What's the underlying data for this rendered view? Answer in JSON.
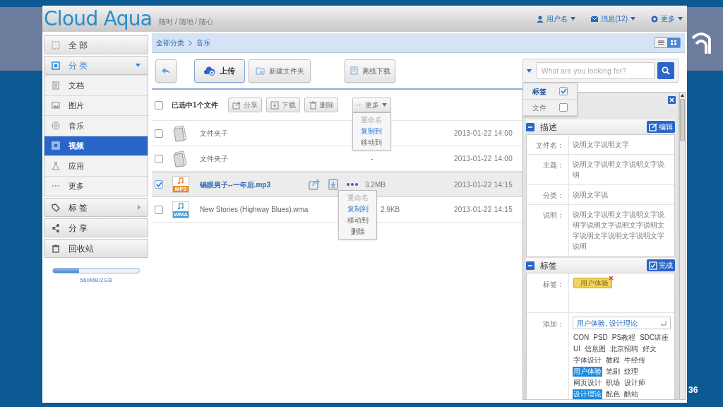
{
  "header": {
    "logo": "Cloud Aqua",
    "slogan": "随时 / 随地 / 随心",
    "user": "用户名",
    "messages": "消息(12)",
    "more": "更多"
  },
  "sidebar": {
    "items": [
      {
        "label": "全 部",
        "selected": false
      },
      {
        "label": "分 类",
        "selected": false,
        "expanded": true,
        "children": [
          {
            "label": "文档",
            "selected": false
          },
          {
            "label": "图片",
            "selected": false
          },
          {
            "label": "音乐",
            "selected": false
          },
          {
            "label": "视频",
            "selected": true
          },
          {
            "label": "应用",
            "selected": false
          },
          {
            "label": "更多",
            "selected": false
          }
        ]
      },
      {
        "label": "标 签",
        "selected": false,
        "expanded": false
      },
      {
        "label": "分 享",
        "selected": false
      },
      {
        "label": "回收站",
        "selected": false
      }
    ],
    "storage": {
      "level": 0.3,
      "reading": "560MB/2GB"
    }
  },
  "breadcrumb": [
    "全部分类",
    "音乐"
  ],
  "view_toggle": [
    {
      "selected": false
    },
    {
      "selected": true
    }
  ],
  "toolbar": {
    "buttons": [
      {
        "label": "上传",
        "selected": true
      },
      {
        "label": "新建文件夹",
        "selected": false
      },
      {
        "label": "离线下载",
        "selected": false
      }
    ]
  },
  "selection_bar": {
    "checked": false,
    "label": "已选中1个文件",
    "actions": [
      "分享",
      "下载",
      "删除"
    ],
    "more": {
      "label": "··· 更多",
      "menu": [
        {
          "label": "重命名",
          "disabled": true,
          "selected": false
        },
        {
          "label": "复制到",
          "disabled": false,
          "selected": true
        },
        {
          "label": "移动到",
          "disabled": false,
          "selected": false
        }
      ]
    }
  },
  "files": [
    {
      "kind": "folder",
      "name": "文件夹子",
      "date": "2013-01-22 14:00",
      "checked": false,
      "selected": false
    },
    {
      "kind": "folder",
      "name": "文件夹子",
      "size": "-",
      "date": "2013-01-22 14:00",
      "checked": false,
      "selected": false
    },
    {
      "kind": "mp3",
      "badge": "MP3",
      "name": "锡眼男子--一年后.mp3",
      "size": "3.2MB",
      "date": "2013-01-22 14:15",
      "checked": true,
      "selected": true
    },
    {
      "kind": "wma",
      "badge": "WMA",
      "name": "New Stories (Highway Blues).wma",
      "size": "2.9KB",
      "date": "2013-01-22 14:15",
      "checked": false,
      "selected": false
    }
  ],
  "context_menu": [
    {
      "label": "重命名",
      "disabled": true,
      "selected": false
    },
    {
      "label": "复制到",
      "disabled": false,
      "selected": true
    },
    {
      "label": "移动到",
      "disabled": false,
      "selected": false
    },
    {
      "label": "删除",
      "disabled": false,
      "selected": false
    }
  ],
  "search": {
    "placeholder": "What are you looking for?",
    "scope_menu": [
      {
        "label": "标签",
        "checked": true
      },
      {
        "label": "文件",
        "checked": false
      }
    ]
  },
  "details": {
    "description": {
      "title": "描述",
      "button": "编辑",
      "fields": [
        {
          "label": "文件名：",
          "value": "说明文字说明文字"
        },
        {
          "label": "主题：",
          "value": "说明文字说明文字说明文字说明"
        },
        {
          "label": "分类：",
          "value": "说明文字说"
        },
        {
          "label": "说明：",
          "value": "说明文字说明文字说明文字说明字说明文字说明文字说明文字说明文字说明文字说明文字说明"
        }
      ]
    },
    "tags": {
      "title": "标签",
      "button": "完成",
      "tag_label": "标签：",
      "tags": [
        "用户体验"
      ],
      "add_label": "添加：",
      "input_value": "用户体验, 设计理论",
      "suggestions": [
        {
          "label": "CON",
          "selected": false
        },
        {
          "label": "PSD",
          "selected": false
        },
        {
          "label": "PS教程",
          "selected": false
        },
        {
          "label": "SDC讲座",
          "selected": false
        },
        {
          "label": "UI",
          "selected": false
        },
        {
          "label": "信息图",
          "selected": false
        },
        {
          "label": "北京招聘",
          "selected": false
        },
        {
          "label": "好文",
          "selected": false
        },
        {
          "label": "字体设计",
          "selected": false
        },
        {
          "label": "教程",
          "selected": false
        },
        {
          "label": "牛经传",
          "selected": false
        },
        {
          "label": "用户体验",
          "selected": true
        },
        {
          "label": "笔刷",
          "selected": false
        },
        {
          "label": "纹理",
          "selected": false
        },
        {
          "label": "网页设计",
          "selected": false
        },
        {
          "label": "职场",
          "selected": false
        },
        {
          "label": "设计师",
          "selected": false
        },
        {
          "label": "设计理论",
          "selected": true
        },
        {
          "label": "配色",
          "selected": false
        },
        {
          "label": "酷站",
          "selected": false
        }
      ]
    }
  },
  "page_number": "36"
}
